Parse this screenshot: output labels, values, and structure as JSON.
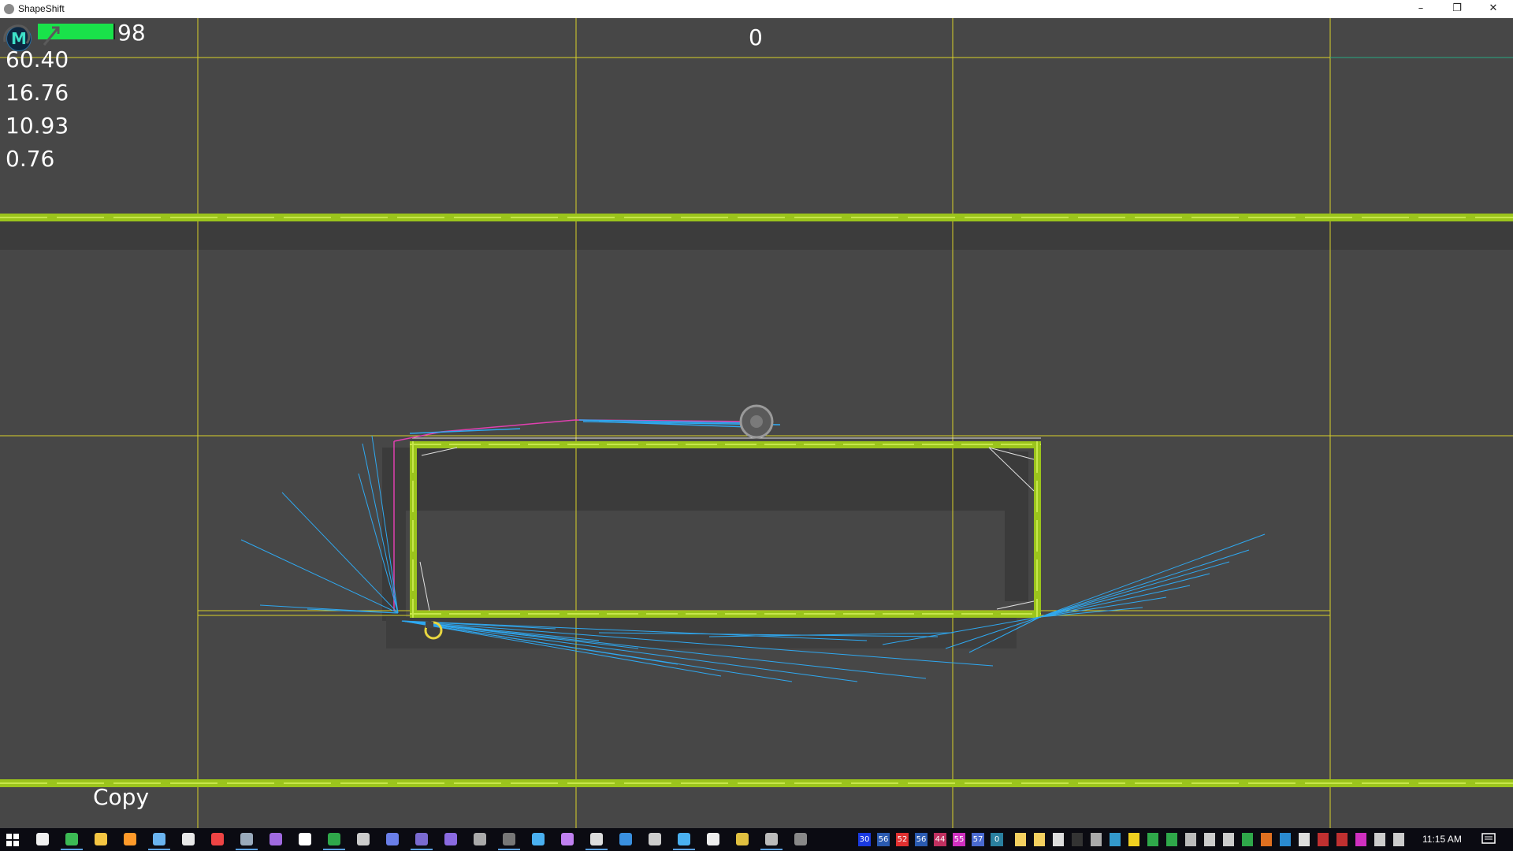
{
  "window": {
    "title": "ShapeShift",
    "minimize_icon": "minimize-icon",
    "restore_icon": "restore-icon",
    "close_icon": "close-icon"
  },
  "hud": {
    "avatar_letter": "M",
    "health_value": "98",
    "health_fraction": 0.98,
    "health_color": "#19e24a",
    "stats": [
      "60.40",
      "16.76",
      "10.93",
      "0.76"
    ],
    "score": "0"
  },
  "toolbar": {
    "copy_label": "Copy"
  },
  "colors": {
    "background": "#474747",
    "platform": "#9bc41c",
    "grid_line": "#d8d02a",
    "ray": "#2fa8f0",
    "magenta_path": "#e040b0"
  },
  "taskbar": {
    "clock": "11:15 AM",
    "tray_numbers": [
      "30",
      "56",
      "52",
      "56",
      "44",
      "55",
      "57",
      "0"
    ],
    "app_icons": [
      "windows-start-icon",
      "task-view-icon",
      "chrome-icon",
      "file-explorer-icon",
      "media-player-icon",
      "notepad-icon",
      "document-icon",
      "game-icon",
      "steam-icon",
      "visual-studio-icon",
      "vs-code-icon",
      "h-app-icon",
      "terminal-icon",
      "discord-icon",
      "eclipse-icon",
      "eclipse-icon",
      "settings-icon",
      "obs-icon",
      "paint-icon",
      "app-icon",
      "chrome-icon",
      "task-manager-icon",
      "network-icon",
      "vscode-icon",
      "photo-icon",
      "git-icon",
      "remote-icon",
      "circle-icon"
    ]
  }
}
